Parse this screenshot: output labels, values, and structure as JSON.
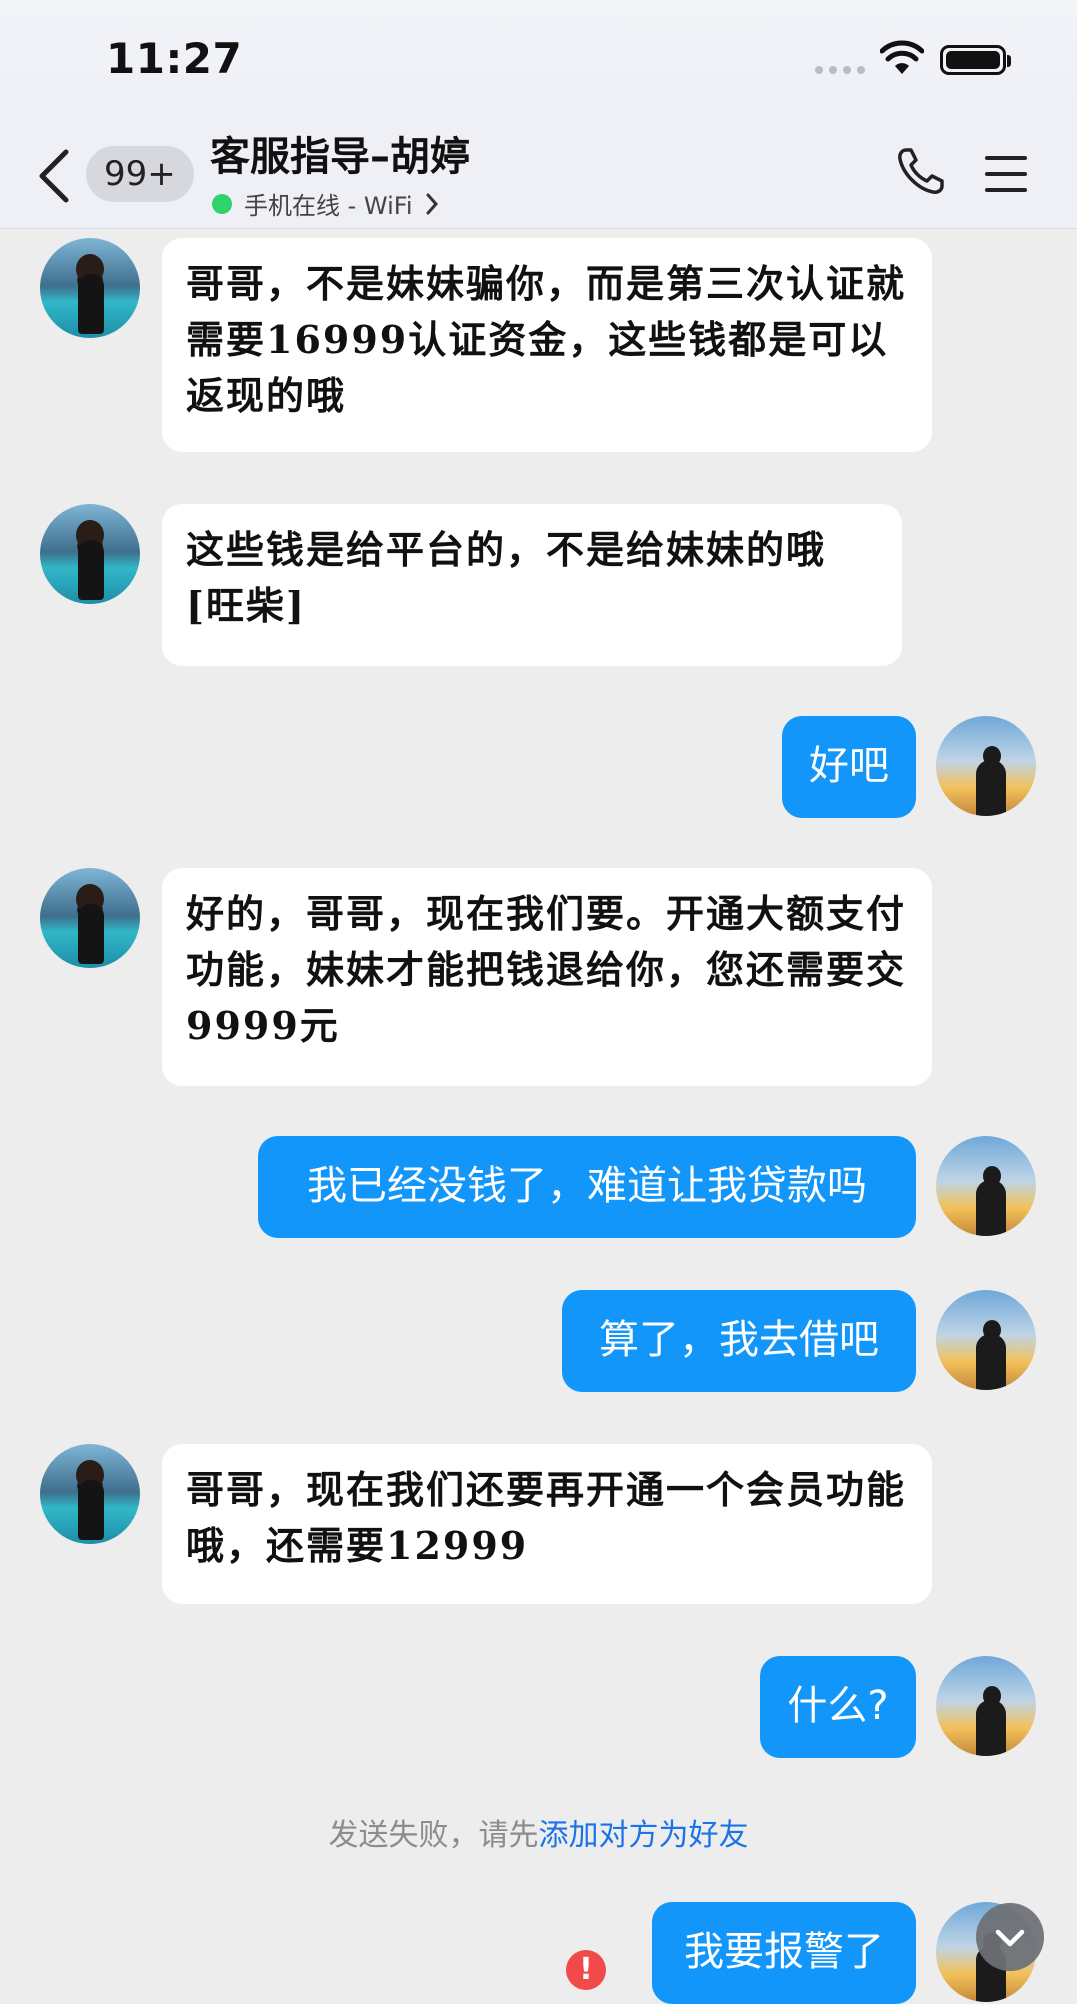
{
  "status_bar": {
    "time": "11:27"
  },
  "header": {
    "unread_badge": "99+",
    "title": "客服指导–胡婷",
    "subtitle": "手机在线 - WiFi"
  },
  "messages": [
    {
      "side": "left",
      "text": "哥哥，不是妹妹骗你，而是第三次认证就需要16999认证资金，这些钱都是可以返现的哦"
    },
    {
      "side": "left",
      "text": "这些钱是给平台的，不是给妹妹的哦[旺柴]"
    },
    {
      "side": "right",
      "text": "好吧"
    },
    {
      "side": "left",
      "text": "好的，哥哥，现在我们要。开通大额支付功能，妹妹才能把钱退给你，您还需要交9999元"
    },
    {
      "side": "right",
      "text": "我已经没钱了，难道让我贷款吗"
    },
    {
      "side": "right",
      "text": "算了，我去借吧"
    },
    {
      "side": "left",
      "text": "哥哥，现在我们还要再开通一个会员功能哦，还需要12999"
    },
    {
      "side": "right",
      "text": "什么?"
    },
    {
      "side": "right",
      "text": "我要报警了"
    }
  ],
  "notice": {
    "text": "发送失败，请先",
    "link": "添加对方为好友"
  },
  "error_mark": "!",
  "icons": {
    "back": "chevron-left-icon",
    "phone": "phone-icon",
    "menu": "menu-icon",
    "scroll": "chevron-down-icon",
    "online": "online-dot-icon"
  },
  "colors": {
    "bubble_right": "#1296f9",
    "bubble_left": "#ffffff",
    "online": "#2fd36b",
    "error": "#f14a4a",
    "link": "#1a73e8"
  }
}
